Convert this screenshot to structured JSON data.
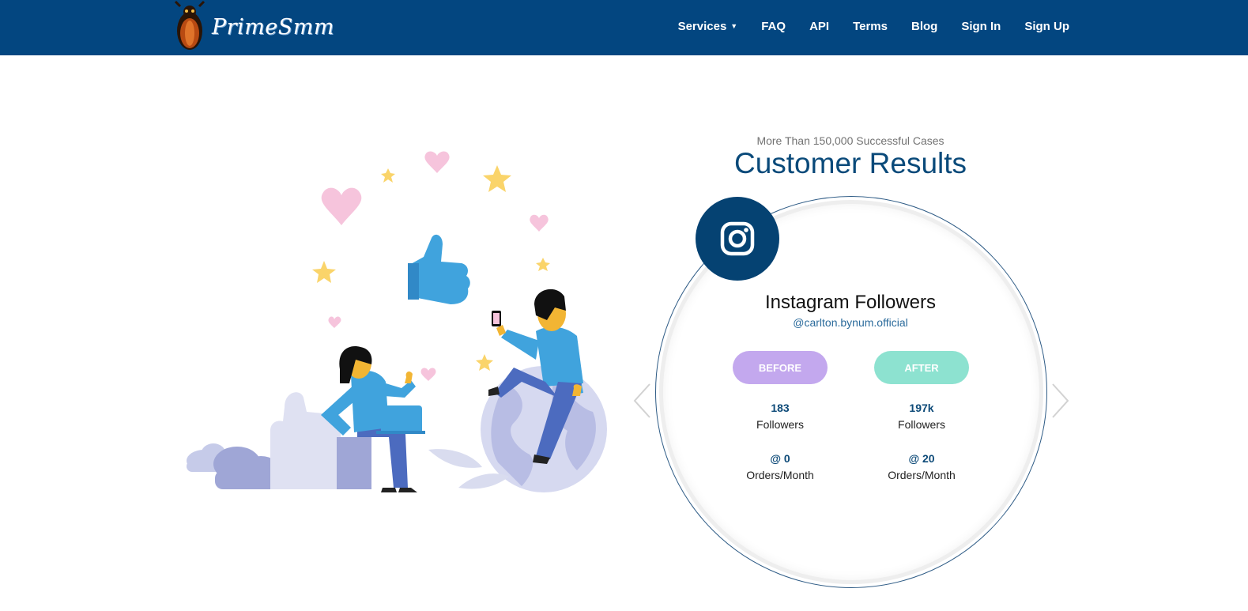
{
  "brand": {
    "name": "PrimeSmm"
  },
  "nav": {
    "services": "Services",
    "faq": "FAQ",
    "api": "API",
    "terms": "Terms",
    "blog": "Blog",
    "signin": "Sign In",
    "signup": "Sign Up"
  },
  "hero": {
    "subtitle": "More Than 150,000 Successful Cases",
    "title": "Customer Results"
  },
  "result": {
    "icon": "instagram-icon",
    "service": "Instagram Followers",
    "handle": "@carlton.bynum.official",
    "before_label": "BEFORE",
    "after_label": "AFTER",
    "before_followers": "183",
    "after_followers": "197k",
    "followers_label": "Followers",
    "before_orders": "@ 0",
    "after_orders": "@ 20",
    "orders_label": "Orders/Month"
  },
  "colors": {
    "nav_bg": "#034680",
    "title": "#0a4a7a",
    "before": "#c3a8ee",
    "after": "#8de2d0",
    "icon_bg": "#054272"
  }
}
